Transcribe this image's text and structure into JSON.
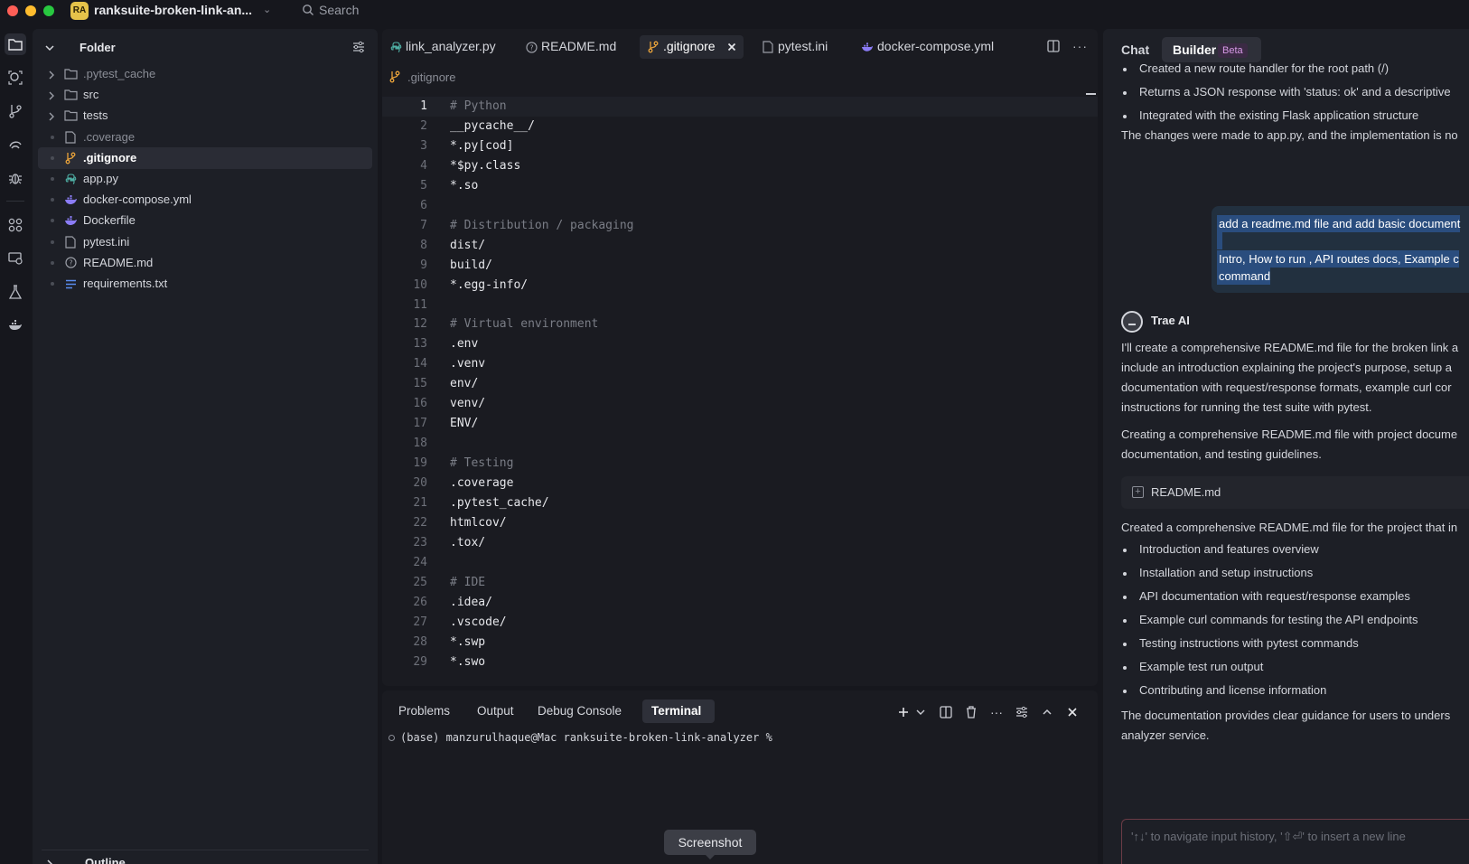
{
  "titlebar": {
    "workspace_badge": "RA",
    "workspace_name": "ranksuite-broken-link-an...",
    "search_label": "Search"
  },
  "explorer": {
    "title": "Folder",
    "items": [
      {
        "name": ".pytest_cache",
        "type": "folder",
        "dim": true
      },
      {
        "name": "src",
        "type": "folder",
        "dim": false
      },
      {
        "name": "tests",
        "type": "folder",
        "dim": false
      },
      {
        "name": ".coverage",
        "type": "file",
        "dim": true
      },
      {
        "name": ".gitignore",
        "type": "git",
        "dim": false,
        "selected": true
      },
      {
        "name": "app.py",
        "type": "python",
        "dim": false
      },
      {
        "name": "docker-compose.yml",
        "type": "docker",
        "dim": false
      },
      {
        "name": "Dockerfile",
        "type": "docker",
        "dim": false
      },
      {
        "name": "pytest.ini",
        "type": "file",
        "dim": false
      },
      {
        "name": "README.md",
        "type": "info",
        "dim": false
      },
      {
        "name": "requirements.txt",
        "type": "list",
        "dim": false
      }
    ],
    "outline_label": "Outline"
  },
  "editor": {
    "tabs": [
      {
        "label": "link_analyzer.py",
        "icon": "python-icon"
      },
      {
        "label": "README.md",
        "icon": "info-icon"
      },
      {
        "label": ".gitignore",
        "icon": "git-icon",
        "active": true
      },
      {
        "label": "pytest.ini",
        "icon": "file-icon"
      },
      {
        "label": "docker-compose.yml",
        "icon": "docker-icon"
      }
    ],
    "breadcrumb": ".gitignore",
    "lines": [
      "# Python",
      "__pycache__/",
      "*.py[cod]",
      "*$py.class",
      "*.so",
      "",
      "# Distribution / packaging",
      "dist/",
      "build/",
      "*.egg-info/",
      "",
      "# Virtual environment",
      ".env",
      ".venv",
      "env/",
      "venv/",
      "ENV/",
      "",
      "# Testing",
      ".coverage",
      ".pytest_cache/",
      "htmlcov/",
      ".tox/",
      "",
      "# IDE",
      ".idea/",
      ".vscode/",
      "*.swp",
      "*.swo"
    ],
    "line_numbers": [
      "1",
      "2",
      "3",
      "4",
      "5",
      "6",
      "7",
      "8",
      "9",
      "10",
      "11",
      "12",
      "13",
      "14",
      "15",
      "16",
      "17",
      "18",
      "19",
      "20",
      "21",
      "22",
      "23",
      "24",
      "25",
      "26",
      "27",
      "28",
      "29"
    ]
  },
  "panel": {
    "tabs": [
      "Problems",
      "Output",
      "Debug Console",
      "Terminal"
    ],
    "active_tab": "Terminal",
    "terminal_line": "(base) manzurulhaque@Mac ranksuite-broken-link-analyzer %",
    "tooltip": "Screenshot"
  },
  "chat": {
    "tab_chat": "Chat",
    "tab_builder": "Builder",
    "builder_badge": "Beta",
    "top_bullets": [
      "Created a new route handler for the root path (/)",
      "Returns a JSON response with 'status: ok' and a descriptive",
      "Integrated with the existing Flask application structure"
    ],
    "top_summary": "The changes were made to app.py, and the implementation is no",
    "user_message": {
      "line1": "add a readme.md file and add basic document",
      "line2": "Intro, How to run , API routes docs, Example c",
      "line3": "command"
    },
    "ai_name": "Trae AI",
    "ai_para1": [
      "I'll create a comprehensive README.md file for the broken link a",
      "include an introduction explaining the project's purpose, setup a",
      "documentation with request/response formats, example curl cor",
      "instructions for running the test suite with pytest."
    ],
    "ai_para2": [
      "Creating a comprehensive README.md file with project docume",
      "documentation, and testing guidelines."
    ],
    "file_chip": "README.md",
    "ai_para3": "Created a comprehensive README.md file for the project that in",
    "bottom_bullets": [
      "Introduction and features overview",
      "Installation and setup instructions",
      "API documentation with request/response examples",
      "Example curl commands for testing the API endpoints",
      "Testing instructions with pytest commands",
      "Example test run output",
      "Contributing and license information"
    ],
    "closing": [
      "The documentation provides clear guidance for users to unders",
      "analyzer service."
    ],
    "input_placeholder": "'↑↓' to navigate input history, '⇧⏎' to insert a new line"
  },
  "colors": {
    "background": "#16171d",
    "panel": "#1d1f26",
    "editor": "#1a1b21",
    "selection": "#2a4d7e",
    "accent_git": "#e8a23a",
    "accent_python": "#4fb0a5",
    "accent_docker": "#8b7cf6"
  }
}
